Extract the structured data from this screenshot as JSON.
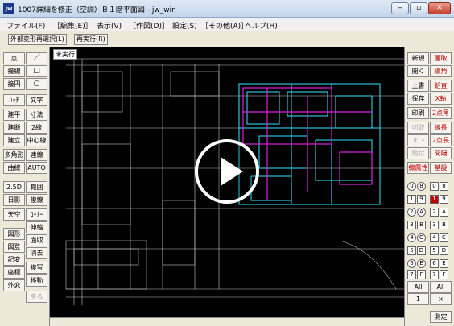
{
  "window": {
    "app_icon": "jw",
    "title": "1007詳細を修正（空調）Ｂ１階平面図 - jw_win",
    "minimize_icon": "minimize-icon",
    "maximize_icon": "maximize-icon",
    "close_icon": "close-icon"
  },
  "menu": [
    "ファイル(F)",
    "［編集(E)］",
    "表示(V)",
    "［作図(D)］",
    "設定(S)",
    "［その他(A)］",
    "ヘルプ(H)"
  ],
  "toolbar": {
    "select_label": "外部変形再選択(L)",
    "redo_label": "再実行(R)"
  },
  "left_panel": {
    "rows": [
      [
        "点",
        "／"
      ],
      [
        "接線",
        "□"
      ],
      [
        "接円",
        "○"
      ],
      [
        "ﾊｯﾁ",
        "文字"
      ],
      [
        "建平",
        "寸法"
      ],
      [
        "建断",
        "2線"
      ],
      [
        "建立",
        "中心線"
      ],
      [
        "多角形",
        "連線"
      ],
      [
        "曲線",
        "AUTO"
      ]
    ],
    "rows2": [
      [
        "2.5D",
        "範囲"
      ],
      [
        "日影",
        "複線"
      ],
      [
        "天空",
        "ｺｰﾅｰ"
      ],
      [
        "",
        "伸縮"
      ],
      [
        "図形",
        "面取"
      ],
      [
        "図登",
        "消去"
      ],
      [
        "記変",
        "複写"
      ],
      [
        "座標",
        "移動"
      ],
      [
        "外変",
        "戻る"
      ]
    ]
  },
  "right_panel": {
    "rows": [
      [
        "新規",
        "厘取"
      ],
      [
        "開く",
        "線角"
      ],
      [
        "上書",
        "鉛直"
      ],
      [
        "保存",
        "X軸"
      ],
      [
        "印刷",
        "2点角"
      ],
      [
        "切取",
        "線長"
      ],
      [
        "ｺﾋﾟｰ",
        "2点長"
      ],
      [
        "貼付",
        "間隔"
      ],
      [
        "線属性",
        "基設"
      ]
    ],
    "layers": [
      [
        "0",
        "8",
        "0",
        "8"
      ],
      [
        "1",
        "9",
        "1",
        "9"
      ],
      [
        "2",
        "A",
        "2",
        "A"
      ],
      [
        "3",
        "B",
        "3",
        "B"
      ],
      [
        "4",
        "C",
        "4",
        "C"
      ],
      [
        "5",
        "D",
        "5",
        "D"
      ],
      [
        "6",
        "E",
        "6",
        "E"
      ],
      [
        "7",
        "F",
        "7",
        "F"
      ]
    ],
    "all_labels": [
      "All",
      "All"
    ],
    "bottom_left": "1",
    "bottom_right": "×",
    "measure": "測定"
  },
  "canvas": {
    "tag": "未実行",
    "play_icon": "play-icon"
  },
  "colors": {
    "cyan": "#33e6ff",
    "magenta": "#e020e0",
    "line": "#c8c8c8",
    "red": "#c00000"
  }
}
